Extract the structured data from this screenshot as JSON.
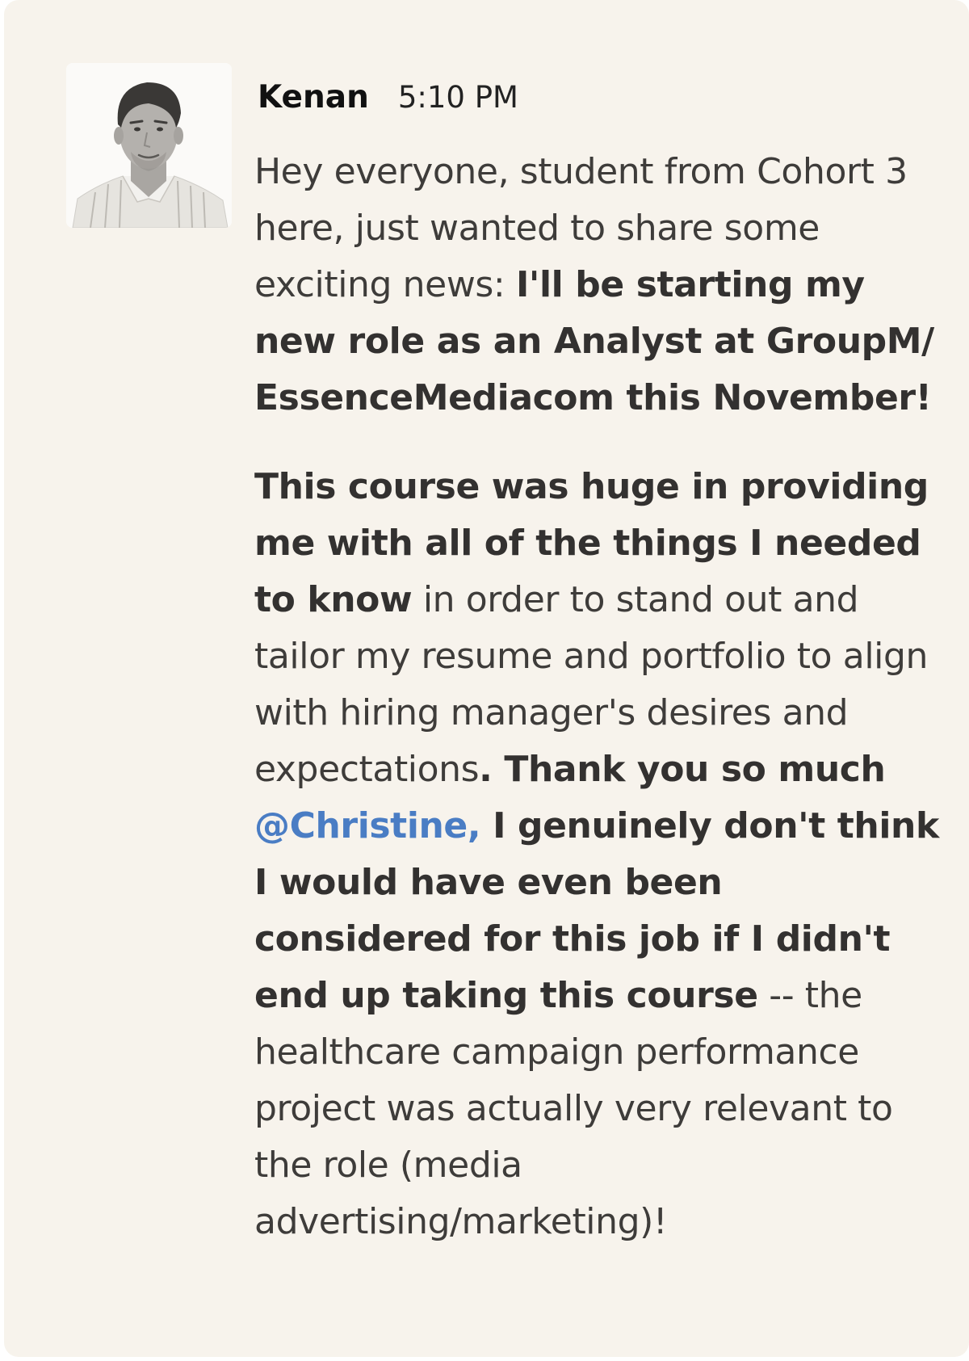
{
  "message": {
    "author": "Kenan",
    "time": "5:10 PM",
    "paragraph1": {
      "intro": "Hey everyone, student from Cohort 3 here, just wanted to share some exciting news: ",
      "news": "I'll be starting my new role as an Analyst at GroupM/ EssenceMediacom this November!"
    },
    "paragraph2": {
      "bold_1": "This course was huge in providing me with all of the things I needed to know",
      "text_1": " in order to stand out and tailor my resume and portfolio to align with hiring manager's desires and expectations",
      "bold_2": ". Thank you so much ",
      "mention": "@Christine,",
      "bold_3": " I genuinely don't think I would have even been considered for this job if I didn't end up taking this course",
      "text_2": " -- the healthcare campaign performance project was actually very relevant to the role (media advertising/marketing)!"
    }
  },
  "avatar": {
    "icon": "user-photo-icon"
  },
  "colors": {
    "card_background": "#f7f3ec",
    "mention": "#4a7dc4",
    "text": "#3e3c3a"
  }
}
